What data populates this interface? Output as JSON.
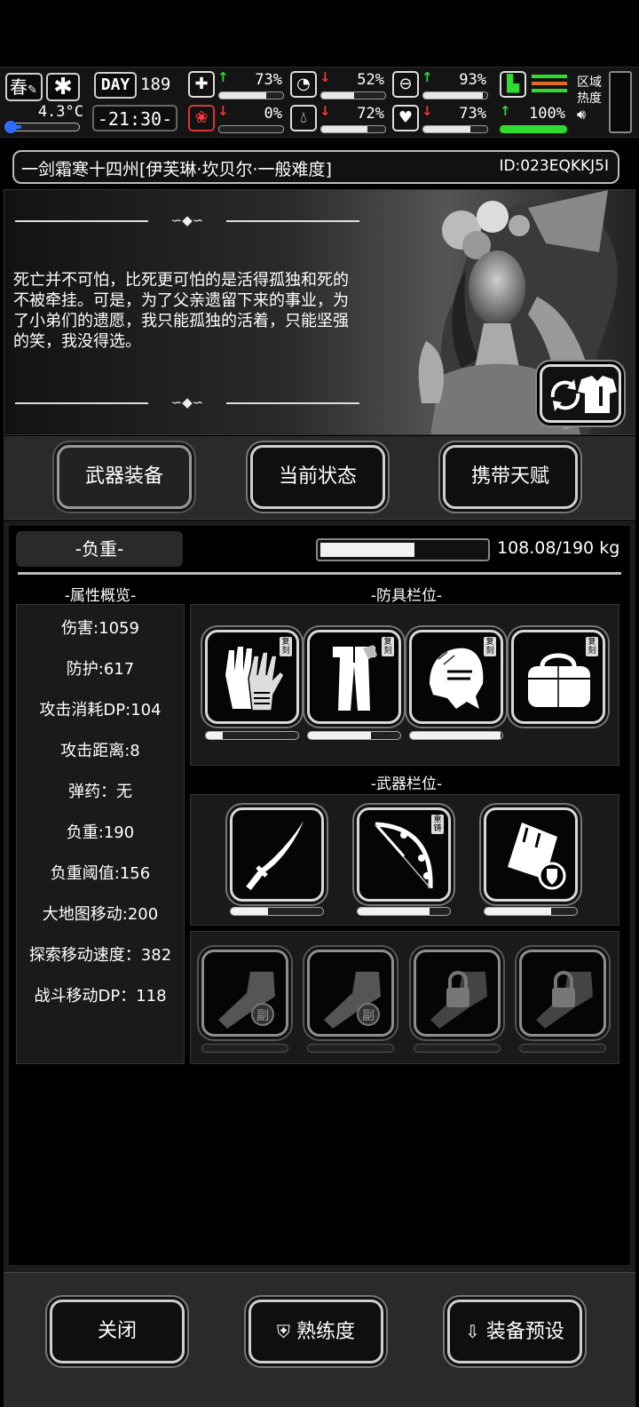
{
  "status": {
    "season": "春",
    "temperature": "4.3°C",
    "temperature_level": 0.12,
    "day_label": "DAY",
    "day_number": "189",
    "clock": "-21:30-",
    "stats": [
      {
        "id": "health",
        "icon": "medkit-icon",
        "trend": "up",
        "value": "73%",
        "level": 0.73
      },
      {
        "id": "hunger",
        "icon": "stomach-icon",
        "trend": "down",
        "value": "52%",
        "level": 0.52
      },
      {
        "id": "stamina",
        "icon": "capsule-icon",
        "trend": "up",
        "value": "93%",
        "level": 0.93
      },
      {
        "id": "sanity",
        "icon": "brain-icon",
        "trend": "down",
        "value": "0%",
        "level": 0.0
      },
      {
        "id": "thirst",
        "icon": "water-drop-icon",
        "trend": "down",
        "value": "72%",
        "level": 0.72
      },
      {
        "id": "mood",
        "icon": "heart-icon",
        "trend": "down",
        "value": "73%",
        "level": 0.73
      }
    ],
    "movement": {
      "icon": "boot-icon",
      "trend": "up",
      "value": "100%",
      "level": 1.0
    },
    "region_label_1": "区域",
    "region_label_2": "热度"
  },
  "title": {
    "text": "一剑霜寒十四州[伊芙琳·坎贝尔·一般难度]",
    "id": "ID:023EQKKJ5I"
  },
  "portrait": {
    "quote": "死亡并不可怕，比死更可怕的是活得孤独和死的不被牵挂。可是，为了父亲遗留下来的事业，为了小弟们的遗愿，我只能孤独的活着，只能坚强的笑，我没得选。"
  },
  "tabs": [
    {
      "label": "武器装备",
      "active": true
    },
    {
      "label": "当前状态",
      "active": false
    },
    {
      "label": "携带天赋",
      "active": false
    }
  ],
  "load": {
    "label": "-负重-",
    "value": "108.08/190 kg",
    "current": 108.08,
    "max": 190
  },
  "attributes": {
    "title": "-属性概览-",
    "items": [
      "伤害:1059",
      "防护:617",
      "攻击消耗DP:104",
      "攻击距离:8",
      "弹药：无",
      "负重:190",
      "负重阈值:156",
      "大地图移动:200",
      "探索移动速度：382",
      "战斗移动DP：118"
    ]
  },
  "armor": {
    "title": "-防具栏位-",
    "slots": [
      {
        "icon": "gauntlets-icon",
        "tag": "复刻",
        "durability": 0.18
      },
      {
        "icon": "coat-icon",
        "tag": "复刻",
        "durability": 0.68
      },
      {
        "icon": "helmet-icon",
        "tag": "复刻",
        "durability": 0.98
      },
      {
        "icon": "bag-icon",
        "tag": "复刻",
        "durability": 0.0
      }
    ]
  },
  "weapons": {
    "title": "-武器栏位-",
    "slots": [
      {
        "icon": "katana-icon",
        "tag": "",
        "durability": 0.4
      },
      {
        "icon": "bow-icon",
        "tag": "重铸",
        "durability": 0.78
      },
      {
        "icon": "shield-case-icon",
        "tag": "",
        "durability": 0.72
      }
    ]
  },
  "extra_slots": [
    {
      "icon": "fist-icon",
      "badge": "副",
      "locked": false
    },
    {
      "icon": "fist-icon",
      "badge": "副",
      "locked": false
    },
    {
      "icon": "fist-icon",
      "badge": "",
      "locked": true
    },
    {
      "icon": "fist-icon",
      "badge": "",
      "locked": true
    }
  ],
  "bottom": {
    "close": "关闭",
    "proficiency": "熟练度",
    "preset": "装备预设"
  }
}
